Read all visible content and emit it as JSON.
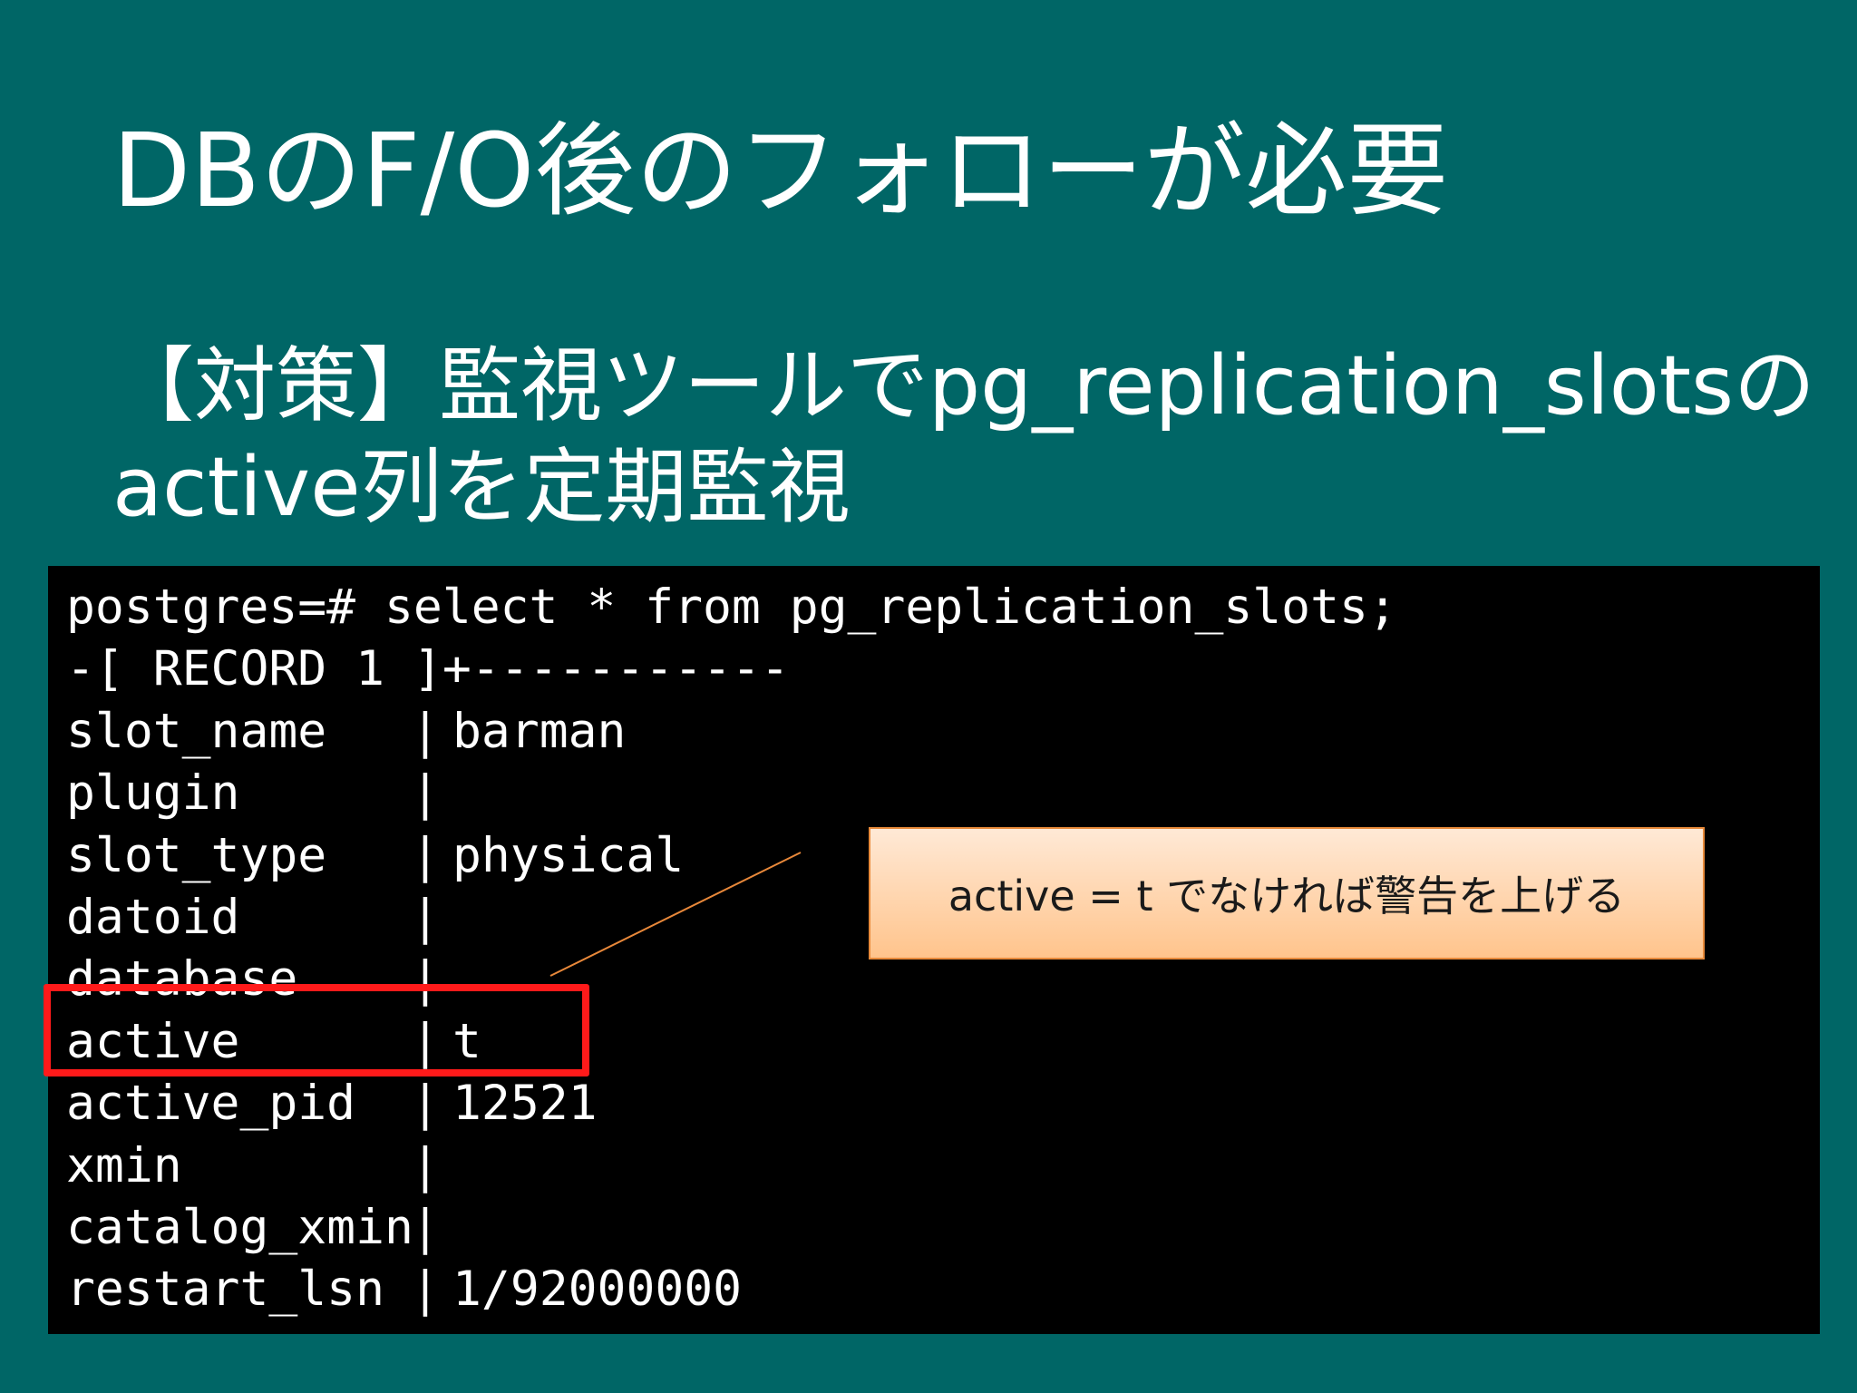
{
  "slide": {
    "title": "DBのF/O後のフォローが必要",
    "subtitle_line1": "【対策】監視ツールでpg_replication_slotsの",
    "subtitle_line2": "active列を定期監視"
  },
  "terminal": {
    "command": "postgres=# select * from pg_replication_slots;",
    "record_header": "-[ RECORD 1 ]+-----------",
    "separator": "|",
    "rows": [
      {
        "field": "slot_name",
        "value": "barman"
      },
      {
        "field": "plugin",
        "value": ""
      },
      {
        "field": "slot_type",
        "value": "physical"
      },
      {
        "field": "datoid",
        "value": ""
      },
      {
        "field": "database",
        "value": ""
      },
      {
        "field": "active",
        "value": "t"
      },
      {
        "field": "active_pid",
        "value": "12521"
      },
      {
        "field": "xmin",
        "value": ""
      },
      {
        "field": "catalog_xmin",
        "value": ""
      },
      {
        "field": "restart_lsn",
        "value": "1/92000000"
      }
    ]
  },
  "callout": {
    "text": "active = t でなければ警告を上げる"
  },
  "colors": {
    "background": "#006666",
    "terminal_bg": "#000000",
    "highlight": "#ff1a1a",
    "callout_line": "#e8883a"
  }
}
